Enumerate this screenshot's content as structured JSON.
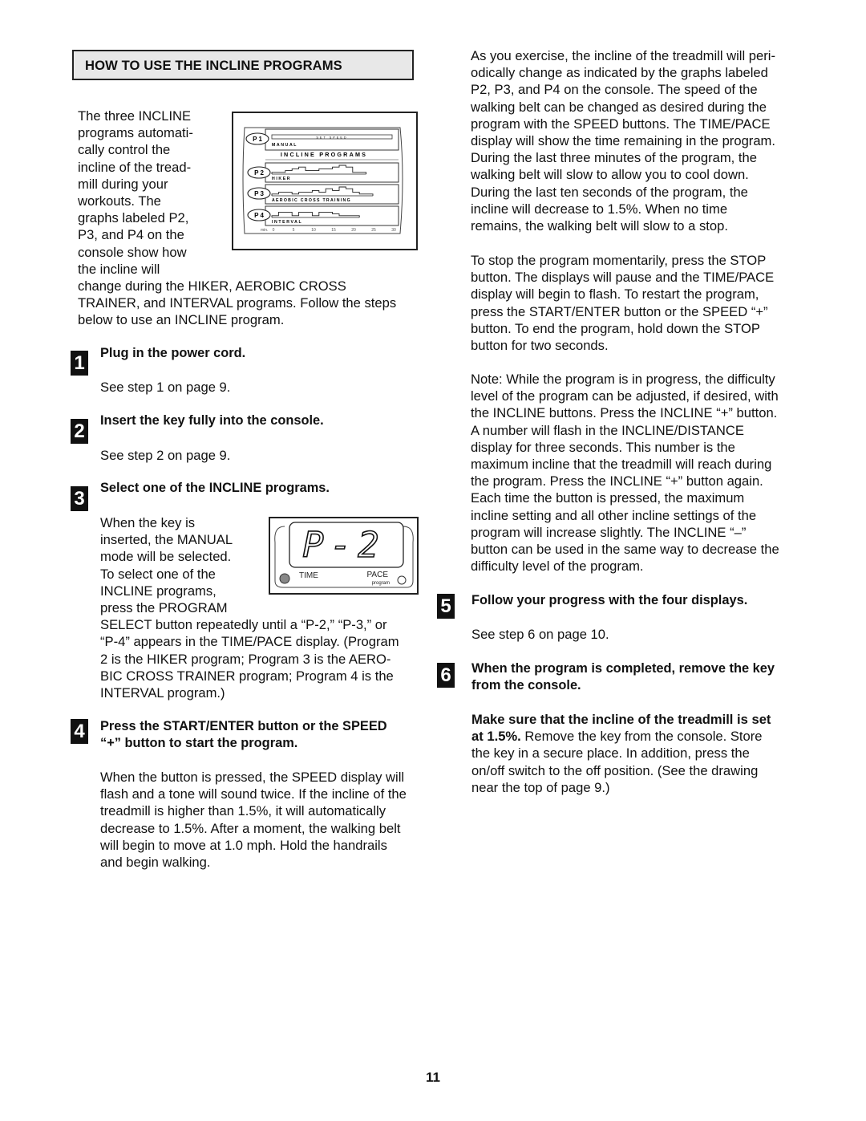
{
  "section_header": "HOW TO USE THE INCLINE PROGRAMS",
  "intro": {
    "wrapped_lines": [
      "The three INCLINE",
      "programs automati-",
      "cally control the",
      "incline of the tread-",
      "mill during your",
      "workouts. The",
      "graphs labeled P2,",
      "P3, and P4 on the",
      "console show how",
      "the incline will"
    ],
    "full_lines": [
      "change during the HIKER, AEROBIC CROSS",
      "TRAINER, and INTERVAL programs. Follow the steps",
      "below to use an INCLINE program."
    ]
  },
  "console_figure": {
    "title": "INCLINE PROGRAMS",
    "set_speed_label": "SET SPEED",
    "programs": [
      {
        "badge": "P 1",
        "name": "MANUAL",
        "profile": []
      },
      {
        "badge": "P 2",
        "name": "HIKER",
        "profile": [
          1,
          1,
          2,
          3,
          4,
          2,
          2,
          3,
          3,
          4,
          5,
          4,
          1,
          1
        ]
      },
      {
        "badge": "P 3",
        "name": "AEROBIC CROSS TRAINING",
        "profile": [
          1,
          2,
          2,
          1,
          2,
          2,
          3,
          2,
          4,
          3,
          5,
          4,
          2,
          1,
          1
        ]
      },
      {
        "badge": "P 4",
        "name": "INTERVAL",
        "profile": [
          1,
          3,
          3,
          1,
          3,
          3,
          1,
          3,
          3,
          2,
          1,
          1,
          1
        ]
      }
    ],
    "axis_label": "min.",
    "axis_ticks": [
      "0",
      "5",
      "10",
      "15",
      "20",
      "25",
      "30"
    ]
  },
  "steps": [
    {
      "number": "1",
      "title": "Plug in the power cord.",
      "body": "See step 1 on page 9."
    },
    {
      "number": "2",
      "title": "Insert the key fully into the console.",
      "body": "See step 2 on page 9."
    },
    {
      "number": "3",
      "title": "Select one of the INCLINE programs.",
      "wrapped_lines": [
        "When the key is",
        "inserted, the MANUAL",
        "mode will be selected.",
        "To select one of the",
        "INCLINE programs,",
        "press the PROGRAM"
      ],
      "full_lines": [
        "SELECT button repeatedly until a “P-2,” “P-3,” or",
        "“P-4” appears in the TIME/PACE display. (Program",
        "2 is the HIKER program; Program 3 is the AERO-",
        "BIC CROSS TRAINER program; Program 4 is the",
        "INTERVAL program.)"
      ]
    },
    {
      "number": "4",
      "title_lines": [
        "Press the START/ENTER button or the SPEED",
        "“+” button to start the program."
      ],
      "body_lines": [
        "When the button is pressed, the SPEED display will",
        "flash and a tone will sound twice. If the incline of the",
        "treadmill is higher than 1.5%, it will automatically",
        "decrease to 1.5%. After a moment, the walking belt",
        "will begin to move at 1.0 mph. Hold the handrails",
        "and begin walking."
      ]
    },
    {
      "number": "5",
      "title": "Follow your progress with the four displays.",
      "body": "See step 6 on page 10."
    },
    {
      "number": "6",
      "title_lines": [
        "When the program is completed, remove the key",
        "from the console."
      ],
      "bold_lead": "Make sure that the incline of the treadmill is set",
      "bold_lead_2": "at 1.5%.",
      "body_rest_first": " Remove the key from the console. Store",
      "body_lines": [
        "the key in a secure place. In addition, press the",
        "on/off switch to the off position. (See the drawing",
        "near the top of page 9.)"
      ]
    }
  ],
  "display_figure": {
    "readout": "P-2",
    "left_label": "TIME",
    "right_label": "PACE",
    "right_sublabel": "program",
    "left_indicator_lit": true,
    "right_indicator_lit": false
  },
  "right_column": {
    "para1": [
      "As you exercise, the incline of the treadmill will peri-",
      "odically change as indicated by the graphs labeled",
      "P2, P3, and P4 on the console. The speed of the",
      "walking belt can be changed as desired during the",
      "program with the SPEED buttons. The TIME/PACE",
      "display will show the time remaining in the program.",
      "During the last three minutes of the program, the",
      "walking belt will slow to allow you to cool down.",
      "During the last ten seconds of the program, the",
      "incline will decrease to 1.5%. When no time",
      "remains, the walking belt will slow to a stop."
    ],
    "para2": [
      "To stop the program momentarily, press the STOP",
      "button. The displays will pause and the TIME/PACE",
      "display will begin to flash. To restart the program,",
      "press the START/ENTER button or the SPEED “+”",
      "button. To end the program, hold down the STOP",
      "button for two seconds."
    ],
    "para3": [
      "Note: While the program is in progress, the difficulty",
      "level of the program can be adjusted, if desired, with",
      "the INCLINE buttons. Press the INCLINE “+” button.",
      "A number will flash in the INCLINE/DISTANCE",
      "display for three seconds. This number is the",
      "maximum incline that the treadmill will reach during",
      "the program. Press the INCLINE “+” button again.",
      "Each time the button is pressed, the maximum",
      "incline setting and all other incline settings of the",
      "program will increase slightly. The INCLINE “–”",
      "button can be used in the same way to decrease the",
      "difficulty level of the program."
    ]
  },
  "page_number": "11"
}
